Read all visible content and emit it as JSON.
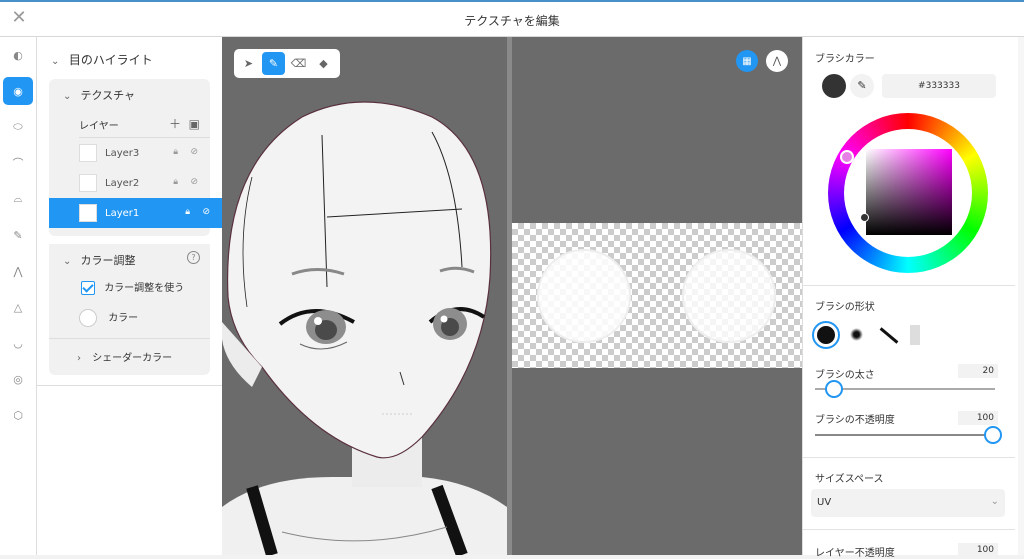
{
  "window": {
    "title": "テクスチャを編集"
  },
  "layers_panel": {
    "root_label": "目のハイライト",
    "texture_group": {
      "label": "テクスチャ",
      "layers_label": "レイヤー",
      "layers": [
        {
          "name": "Layer3"
        },
        {
          "name": "Layer2"
        },
        {
          "name": "Layer1",
          "selected": true
        }
      ]
    },
    "color_adjust": {
      "label": "カラー調整",
      "use_label": "カラー調整を使う",
      "use_checked": true,
      "color_label": "カラー"
    },
    "shader_color_label": "シェーダーカラー"
  },
  "right_panel": {
    "brush_color_label": "ブラシカラー",
    "brush_color_hex": "#333333",
    "brush_shape_label": "ブラシの形状",
    "brush_size_label": "ブラシの太さ",
    "brush_size_value": "20",
    "brush_opacity_label": "ブラシの不透明度",
    "brush_opacity_value": "100",
    "size_space_label": "サイズスペース",
    "size_space_value": "UV",
    "layer_opacity_label": "レイヤー不透明度",
    "layer_opacity_value": "100"
  },
  "colors": {
    "accent": "#2196f3",
    "canvas_bg": "#6b6b6b"
  }
}
